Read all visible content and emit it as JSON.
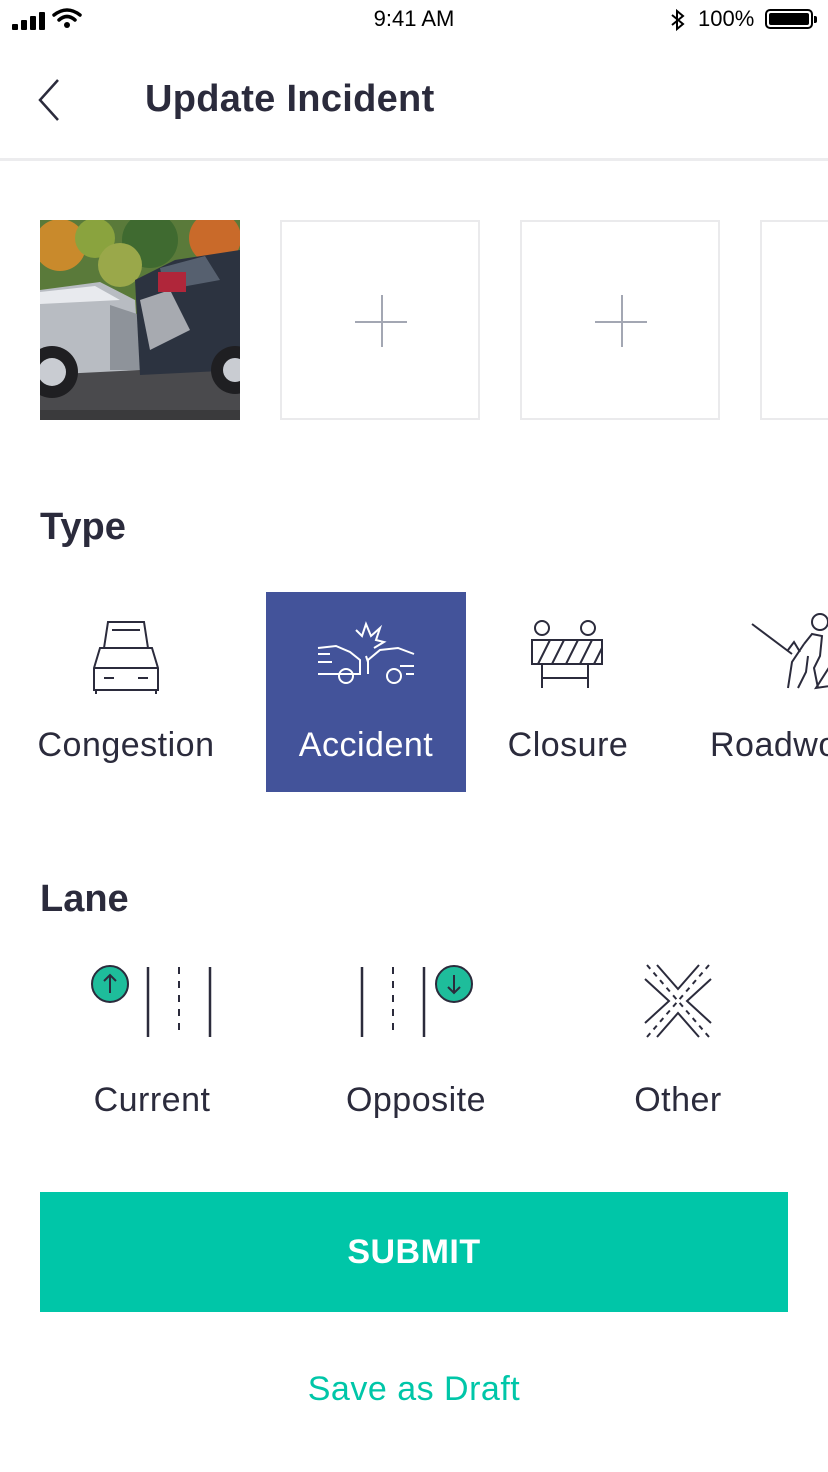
{
  "status_bar": {
    "time": "9:41 AM",
    "battery_percent": "100%"
  },
  "header": {
    "title": "Update Incident",
    "back_icon": "chevron-left-icon"
  },
  "photos": [
    {
      "kind": "photo",
      "description_icon": "car-accident-photo"
    },
    {
      "kind": "add",
      "icon": "plus-icon"
    },
    {
      "kind": "add",
      "icon": "plus-icon"
    },
    {
      "kind": "add",
      "icon": "plus-icon"
    }
  ],
  "type_section": {
    "title": "Type",
    "options": [
      {
        "label": "Congestion",
        "icon": "congestion-icon",
        "selected": false
      },
      {
        "label": "Accident",
        "icon": "accident-icon",
        "selected": true
      },
      {
        "label": "Closure",
        "icon": "closure-barrier-icon",
        "selected": false
      },
      {
        "label": "Roadworks",
        "icon": "roadworker-icon",
        "selected": false
      }
    ]
  },
  "lane_section": {
    "title": "Lane",
    "options": [
      {
        "label": "Current",
        "icon": "current-lane-icon"
      },
      {
        "label": "Opposite",
        "icon": "opposite-lane-icon"
      },
      {
        "label": "Other",
        "icon": "other-lane-icon"
      }
    ]
  },
  "actions": {
    "submit_label": "SUBMIT",
    "draft_label": "Save as Draft"
  },
  "colors": {
    "accent": "#00c6a8",
    "selected_tile": "#43539a",
    "text": "#2b2b3c",
    "lane_arrow": "#1ebd9b"
  }
}
